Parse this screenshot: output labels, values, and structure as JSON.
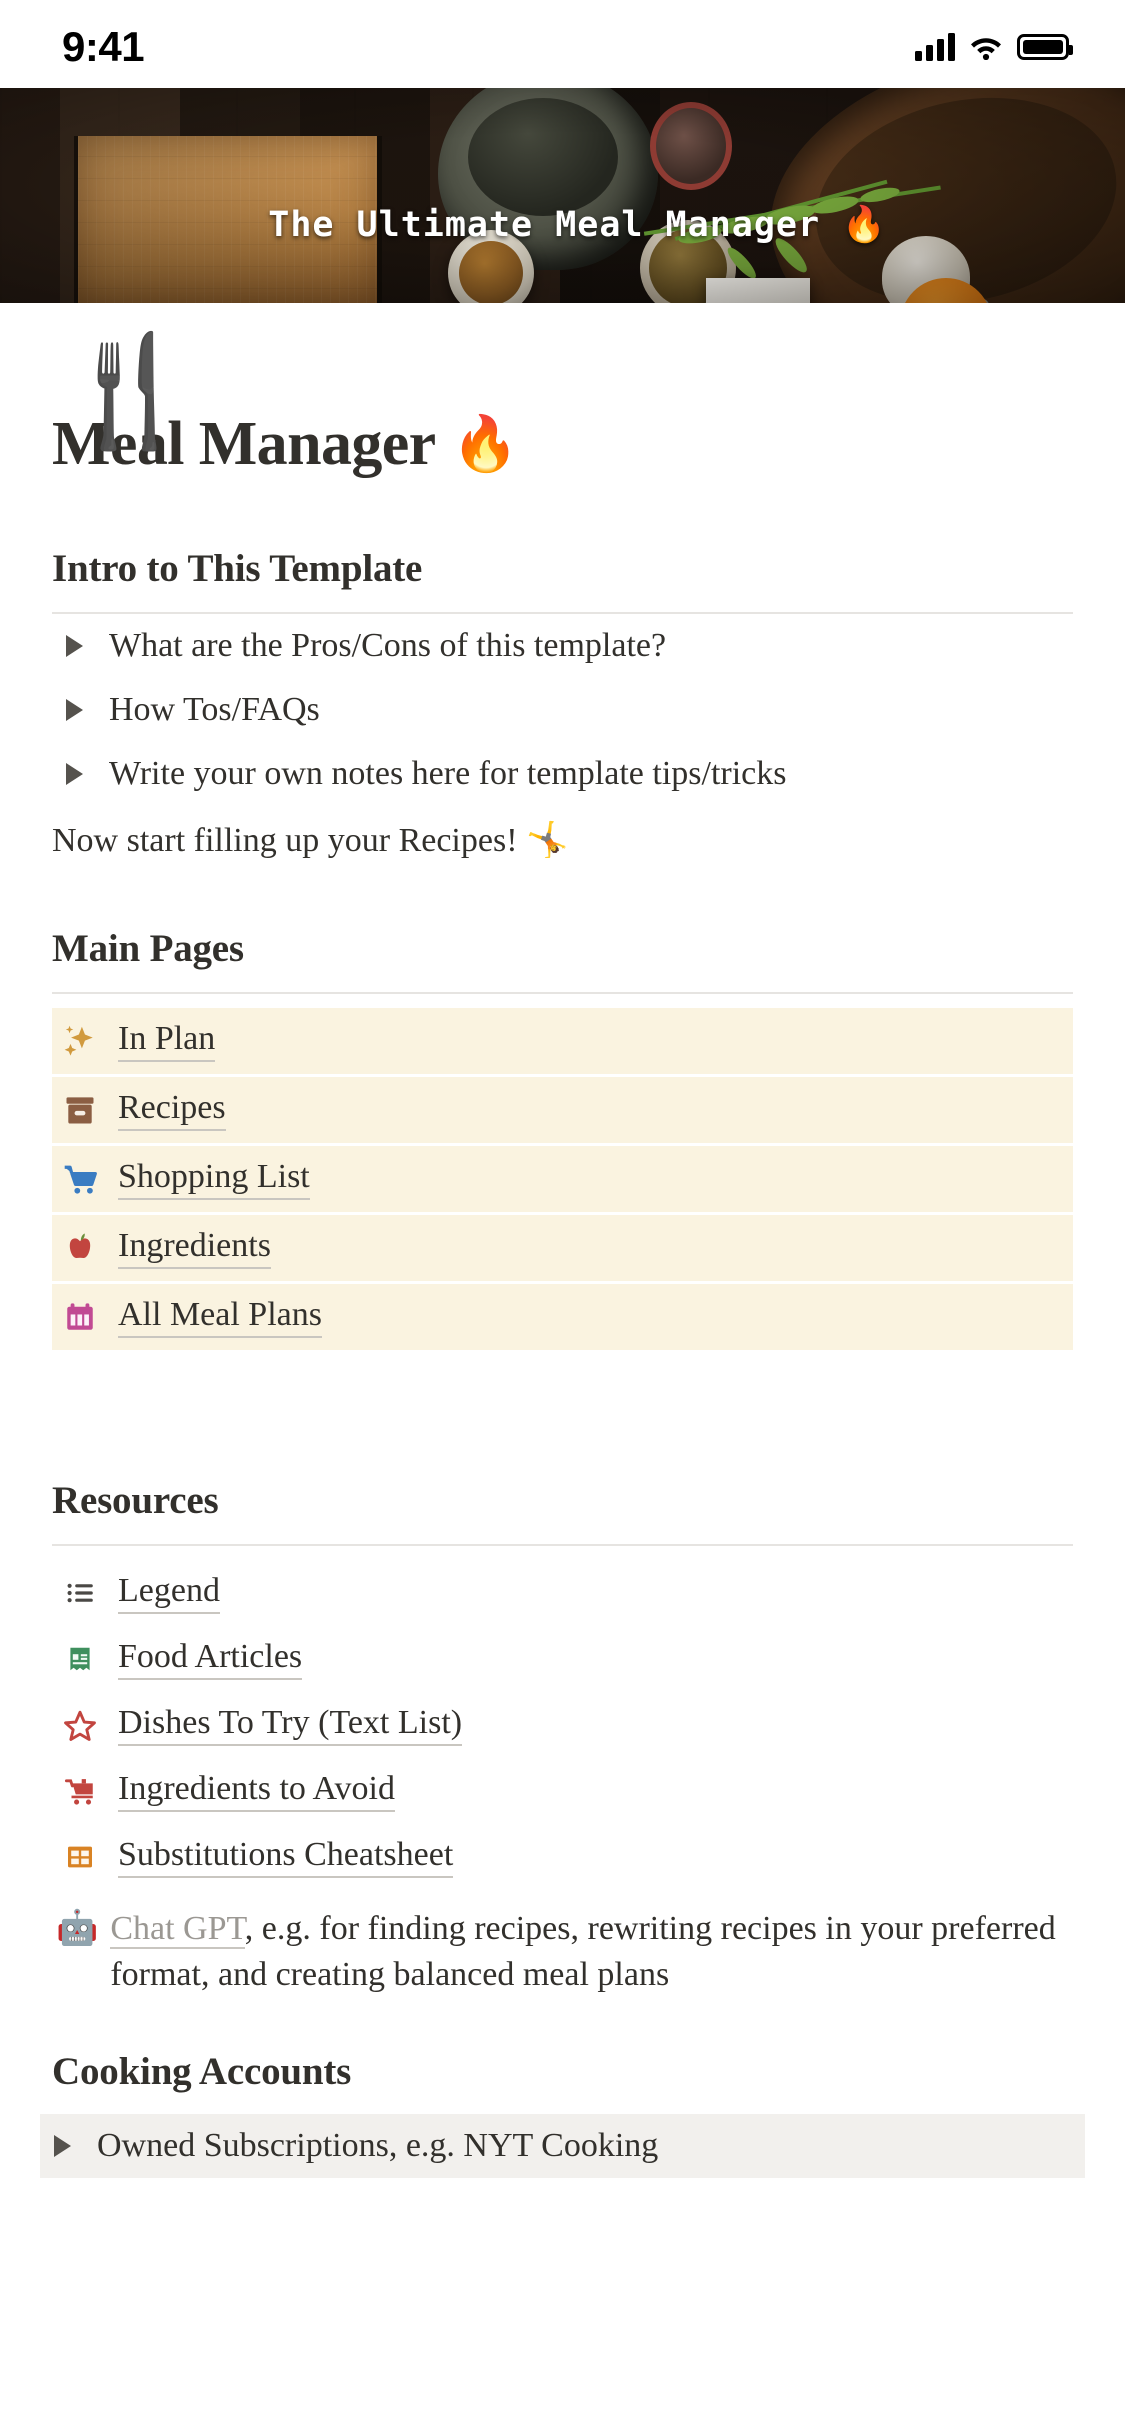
{
  "status_bar": {
    "time": "9:41",
    "cellular_icon": "signal-bars-icon",
    "wifi_icon": "wifi-icon",
    "battery_icon": "battery-full-icon"
  },
  "cover": {
    "title": "The Ultimate Meal Manager 🔥",
    "image_description": "dark-wooden-table-with-cutting-board-mortar-pestle-herbs-spices"
  },
  "page": {
    "icon": "🍴",
    "title": "Meal Manager",
    "title_emoji": "🔥"
  },
  "intro": {
    "heading": "Intro to This Template",
    "toggles": [
      {
        "label": "What are the Pros/Cons of this template?"
      },
      {
        "label": "How Tos/FAQs"
      },
      {
        "label": "Write your own notes here for template tips/tricks"
      }
    ],
    "footer_text": "Now start filling up your Recipes! 🤸"
  },
  "main_pages": {
    "heading": "Main Pages",
    "items": [
      {
        "label": "In Plan",
        "icon": "sparkles-icon",
        "emoji": "✨",
        "color": "#d19a3e"
      },
      {
        "label": "Recipes",
        "icon": "file-box-icon",
        "emoji": "🗃️",
        "color": "#8b5e43"
      },
      {
        "label": "Shopping List",
        "icon": "shopping-cart-icon",
        "emoji": "🛒",
        "color": "#3a7cc2"
      },
      {
        "label": "Ingredients",
        "icon": "apple-icon",
        "emoji": "🍎",
        "color": "#c2453f"
      },
      {
        "label": "All Meal Plans",
        "icon": "calendar-icon",
        "emoji": "📅",
        "color": "#c14a93"
      }
    ]
  },
  "resources": {
    "heading": "Resources",
    "items": [
      {
        "label": "Legend",
        "icon": "bullet-list-icon",
        "emoji": "☰",
        "color": "#4a4845"
      },
      {
        "label": "Food Articles",
        "icon": "receipt-icon",
        "emoji": "🧾",
        "color": "#3f8f5e"
      },
      {
        "label": "Dishes To Try (Text List)",
        "icon": "star-outline-icon",
        "emoji": "⭐",
        "color": "#c2453f"
      },
      {
        "label": "Ingredients to Avoid",
        "icon": "shopping-cart-red-icon",
        "emoji": "🛒",
        "color": "#c2453f"
      },
      {
        "label": "Substitutions Cheatsheet",
        "icon": "table-grid-icon",
        "emoji": "▦",
        "color": "#d98324"
      }
    ],
    "gpt_line": {
      "emoji": "🤖",
      "link_label": "Chat GPT",
      "rest_text": ", e.g. for finding recipes, rewriting recipes in your preferred format, and creating balanced meal plans"
    }
  },
  "cooking_accounts": {
    "heading": "Cooking Accounts",
    "toggles": [
      {
        "label": "Owned Subscriptions, e.g. NYT Cooking"
      }
    ]
  }
}
